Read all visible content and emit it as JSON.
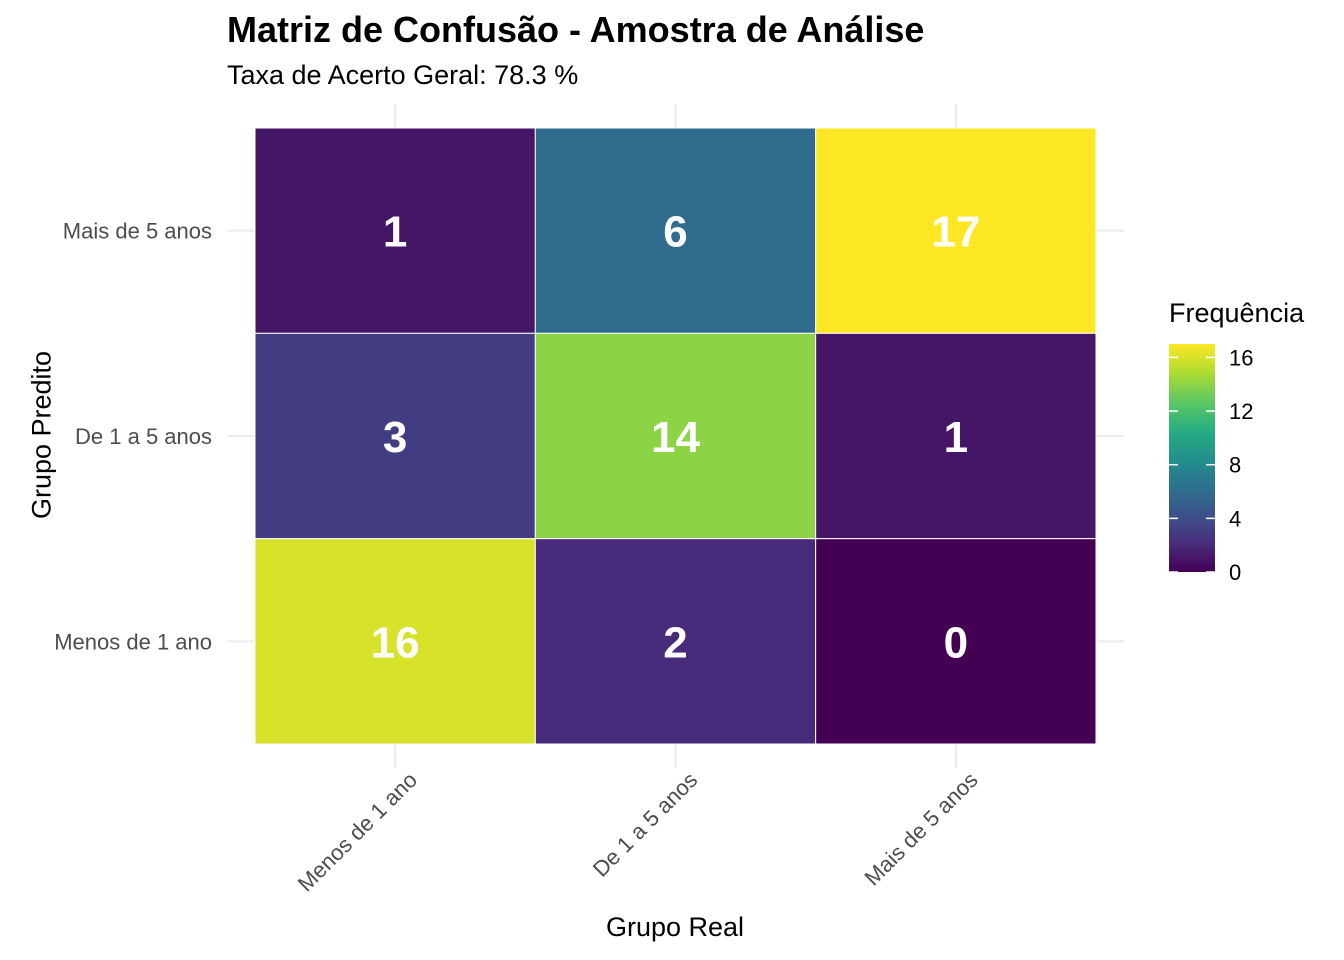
{
  "chart_data": {
    "type": "heatmap",
    "title": "Matriz de Confusão - Amostra de Análise",
    "subtitle": "Taxa de Acerto Geral: 78.3 %",
    "xlabel": "Grupo Real",
    "ylabel": "Grupo Predito",
    "x_categories": [
      "Menos de 1 ano",
      "De 1 a 5 anos",
      "Mais de 5 anos"
    ],
    "y_categories": [
      "Menos de 1 ano",
      "De 1 a 5 anos",
      "Mais de 5 anos"
    ],
    "cells": [
      {
        "real": "Menos de 1 ano",
        "predito": "Mais de 5 anos",
        "value": 1
      },
      {
        "real": "De 1 a 5 anos",
        "predito": "Mais de 5 anos",
        "value": 6
      },
      {
        "real": "Mais de 5 anos",
        "predito": "Mais de 5 anos",
        "value": 17
      },
      {
        "real": "Menos de 1 ano",
        "predito": "De 1 a 5 anos",
        "value": 3
      },
      {
        "real": "De 1 a 5 anos",
        "predito": "De 1 a 5 anos",
        "value": 14
      },
      {
        "real": "Mais de 5 anos",
        "predito": "De 1 a 5 anos",
        "value": 1
      },
      {
        "real": "Menos de 1 ano",
        "predito": "Menos de 1 ano",
        "value": 16
      },
      {
        "real": "De 1 a 5 anos",
        "predito": "Menos de 1 ano",
        "value": 2
      },
      {
        "real": "Mais de 5 anos",
        "predito": "Menos de 1 ano",
        "value": 0
      }
    ],
    "legend": {
      "title": "Frequência",
      "ticks": [
        0,
        4,
        8,
        12,
        16
      ],
      "range": [
        0,
        17
      ],
      "placement": "right"
    },
    "colorscale": "viridis",
    "grid": true
  }
}
